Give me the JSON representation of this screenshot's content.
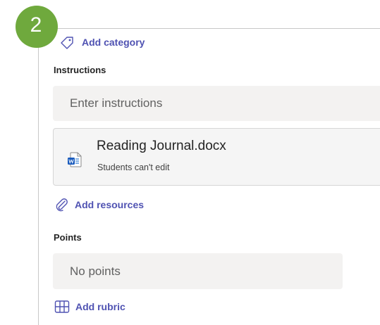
{
  "step": {
    "number": "2"
  },
  "category": {
    "add_label": "Add category"
  },
  "instructions": {
    "label": "Instructions",
    "placeholder": "Enter instructions"
  },
  "resource": {
    "file_name": "Reading Journal.docx",
    "permission": "Students can't edit"
  },
  "resources": {
    "add_label": "Add resources"
  },
  "points": {
    "label": "Points",
    "value": "No points"
  },
  "rubric": {
    "add_label": "Add rubric"
  },
  "colors": {
    "accent": "#4f52b2",
    "badge": "#6fa93d",
    "field_bg": "#f3f2f1"
  }
}
